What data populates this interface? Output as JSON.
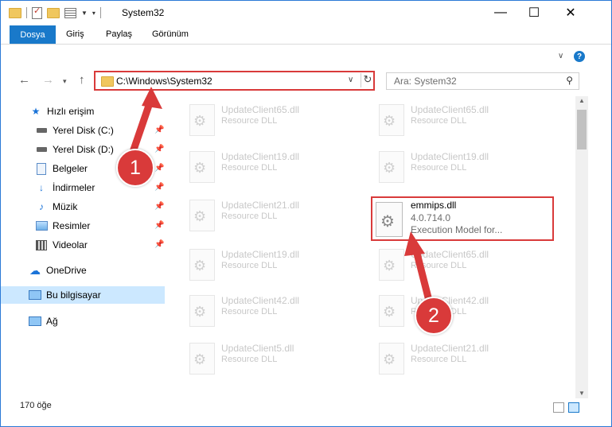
{
  "window": {
    "title": "System32"
  },
  "ribbon": {
    "tabs": [
      "Dosya",
      "Giriş",
      "Paylaş",
      "Görünüm"
    ]
  },
  "address": {
    "path": "C:\\Windows\\System32"
  },
  "search": {
    "placeholder": "Ara: System32"
  },
  "sidebar": {
    "items": [
      {
        "label": "Hızlı erişim",
        "icon": "star-icon"
      },
      {
        "label": "Yerel Disk (C:)",
        "icon": "drive-icon"
      },
      {
        "label": "Yerel Disk (D:)",
        "icon": "drive-icon"
      },
      {
        "label": "Belgeler",
        "icon": "documents-icon"
      },
      {
        "label": "İndirmeler",
        "icon": "download-icon"
      },
      {
        "label": "Müzik",
        "icon": "music-icon"
      },
      {
        "label": "Resimler",
        "icon": "pictures-icon"
      },
      {
        "label": "Videolar",
        "icon": "video-icon"
      },
      {
        "label": "OneDrive",
        "icon": "cloud-icon"
      },
      {
        "label": "Bu bilgisayar",
        "icon": "computer-icon"
      },
      {
        "label": "Ağ",
        "icon": "network-icon"
      }
    ]
  },
  "files": {
    "left": [
      {
        "name": "UpdateClient65.dll",
        "type": "Resource DLL"
      },
      {
        "name": "UpdateClient19.dll",
        "type": "Resource DLL"
      },
      {
        "name": "UpdateClient21.dll",
        "type": "Resource DLL"
      },
      {
        "name": "UpdateClient19.dll",
        "type": "Resource DLL"
      },
      {
        "name": "UpdateClient42.dll",
        "type": "Resource DLL"
      },
      {
        "name": "UpdateClient5.dll",
        "type": "Resource DLL"
      }
    ],
    "right": [
      {
        "name": "UpdateClient65.dll",
        "type": "Resource DLL"
      },
      {
        "name": "UpdateClient19.dll",
        "type": "Resource DLL"
      },
      {
        "name": "UpdateClient65.dll",
        "type": "Resource DLL"
      },
      {
        "name": "UpdateClient42.dll",
        "type": "Resource DLL"
      },
      {
        "name": "UpdateClient21.dll",
        "type": "Resource DLL"
      }
    ],
    "highlighted": {
      "name": "emmips.dll",
      "version": "4.0.714.0",
      "description": "Execution Model for..."
    }
  },
  "status": {
    "count": "170 öğe"
  },
  "annotations": {
    "step1": "1",
    "step2": "2",
    "color": "#d93a3a"
  }
}
